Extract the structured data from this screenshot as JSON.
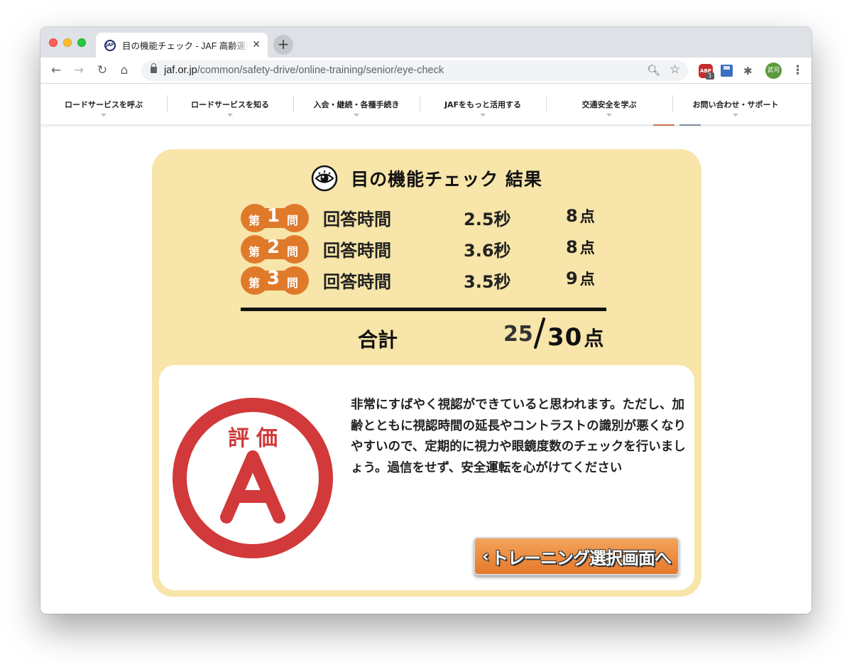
{
  "browser": {
    "tab_title": "目の機能チェック - JAF 高齢運転",
    "tab_favicon_text": "JAF",
    "url_host": "jaf.or.jp",
    "url_path": "/common/safety-drive/online-training/senior/eye-check",
    "ext_abp_text": "ABP",
    "ext_abp_badge": "1",
    "avatar_text": "武司"
  },
  "site_nav": {
    "items": [
      {
        "label": "ロードサービスを呼ぶ"
      },
      {
        "label": "ロードサービスを知る"
      },
      {
        "label": "入会・継続・各種手続き"
      },
      {
        "label": "JAFをもっと活用する"
      },
      {
        "label": "交通安全を学ぶ"
      },
      {
        "label": "お問い合わせ・サポート"
      }
    ]
  },
  "result": {
    "title": "目の機能チェック 結果",
    "badge_prefix": "第",
    "badge_suffix": "問",
    "point_unit": "点",
    "questions": [
      {
        "number": "1",
        "label": "回答時間",
        "time": "2.5秒",
        "score": "8"
      },
      {
        "number": "2",
        "label": "回答時間",
        "time": "3.6秒",
        "score": "8"
      },
      {
        "number": "3",
        "label": "回答時間",
        "time": "3.5秒",
        "score": "9"
      }
    ],
    "total_label": "合計",
    "total_score": "25",
    "total_max": "30",
    "grade_label": "評価",
    "grade": "A",
    "message": "非常にすばやく視認ができていると思われます。ただし、加齢とともに視認時間の延長やコントラストの識別が悪くなりやすいので、定期的に視力や眼鏡度数のチェックを行いましょう。過信をせず、安全運転を心がけてください",
    "back_button": "トレーニング選択画面へ"
  },
  "colors": {
    "card_bg": "#f7e5a9",
    "badge_orange": "#e07a2b",
    "grade_red": "#d1393a",
    "button_orange": "#e5782a"
  }
}
